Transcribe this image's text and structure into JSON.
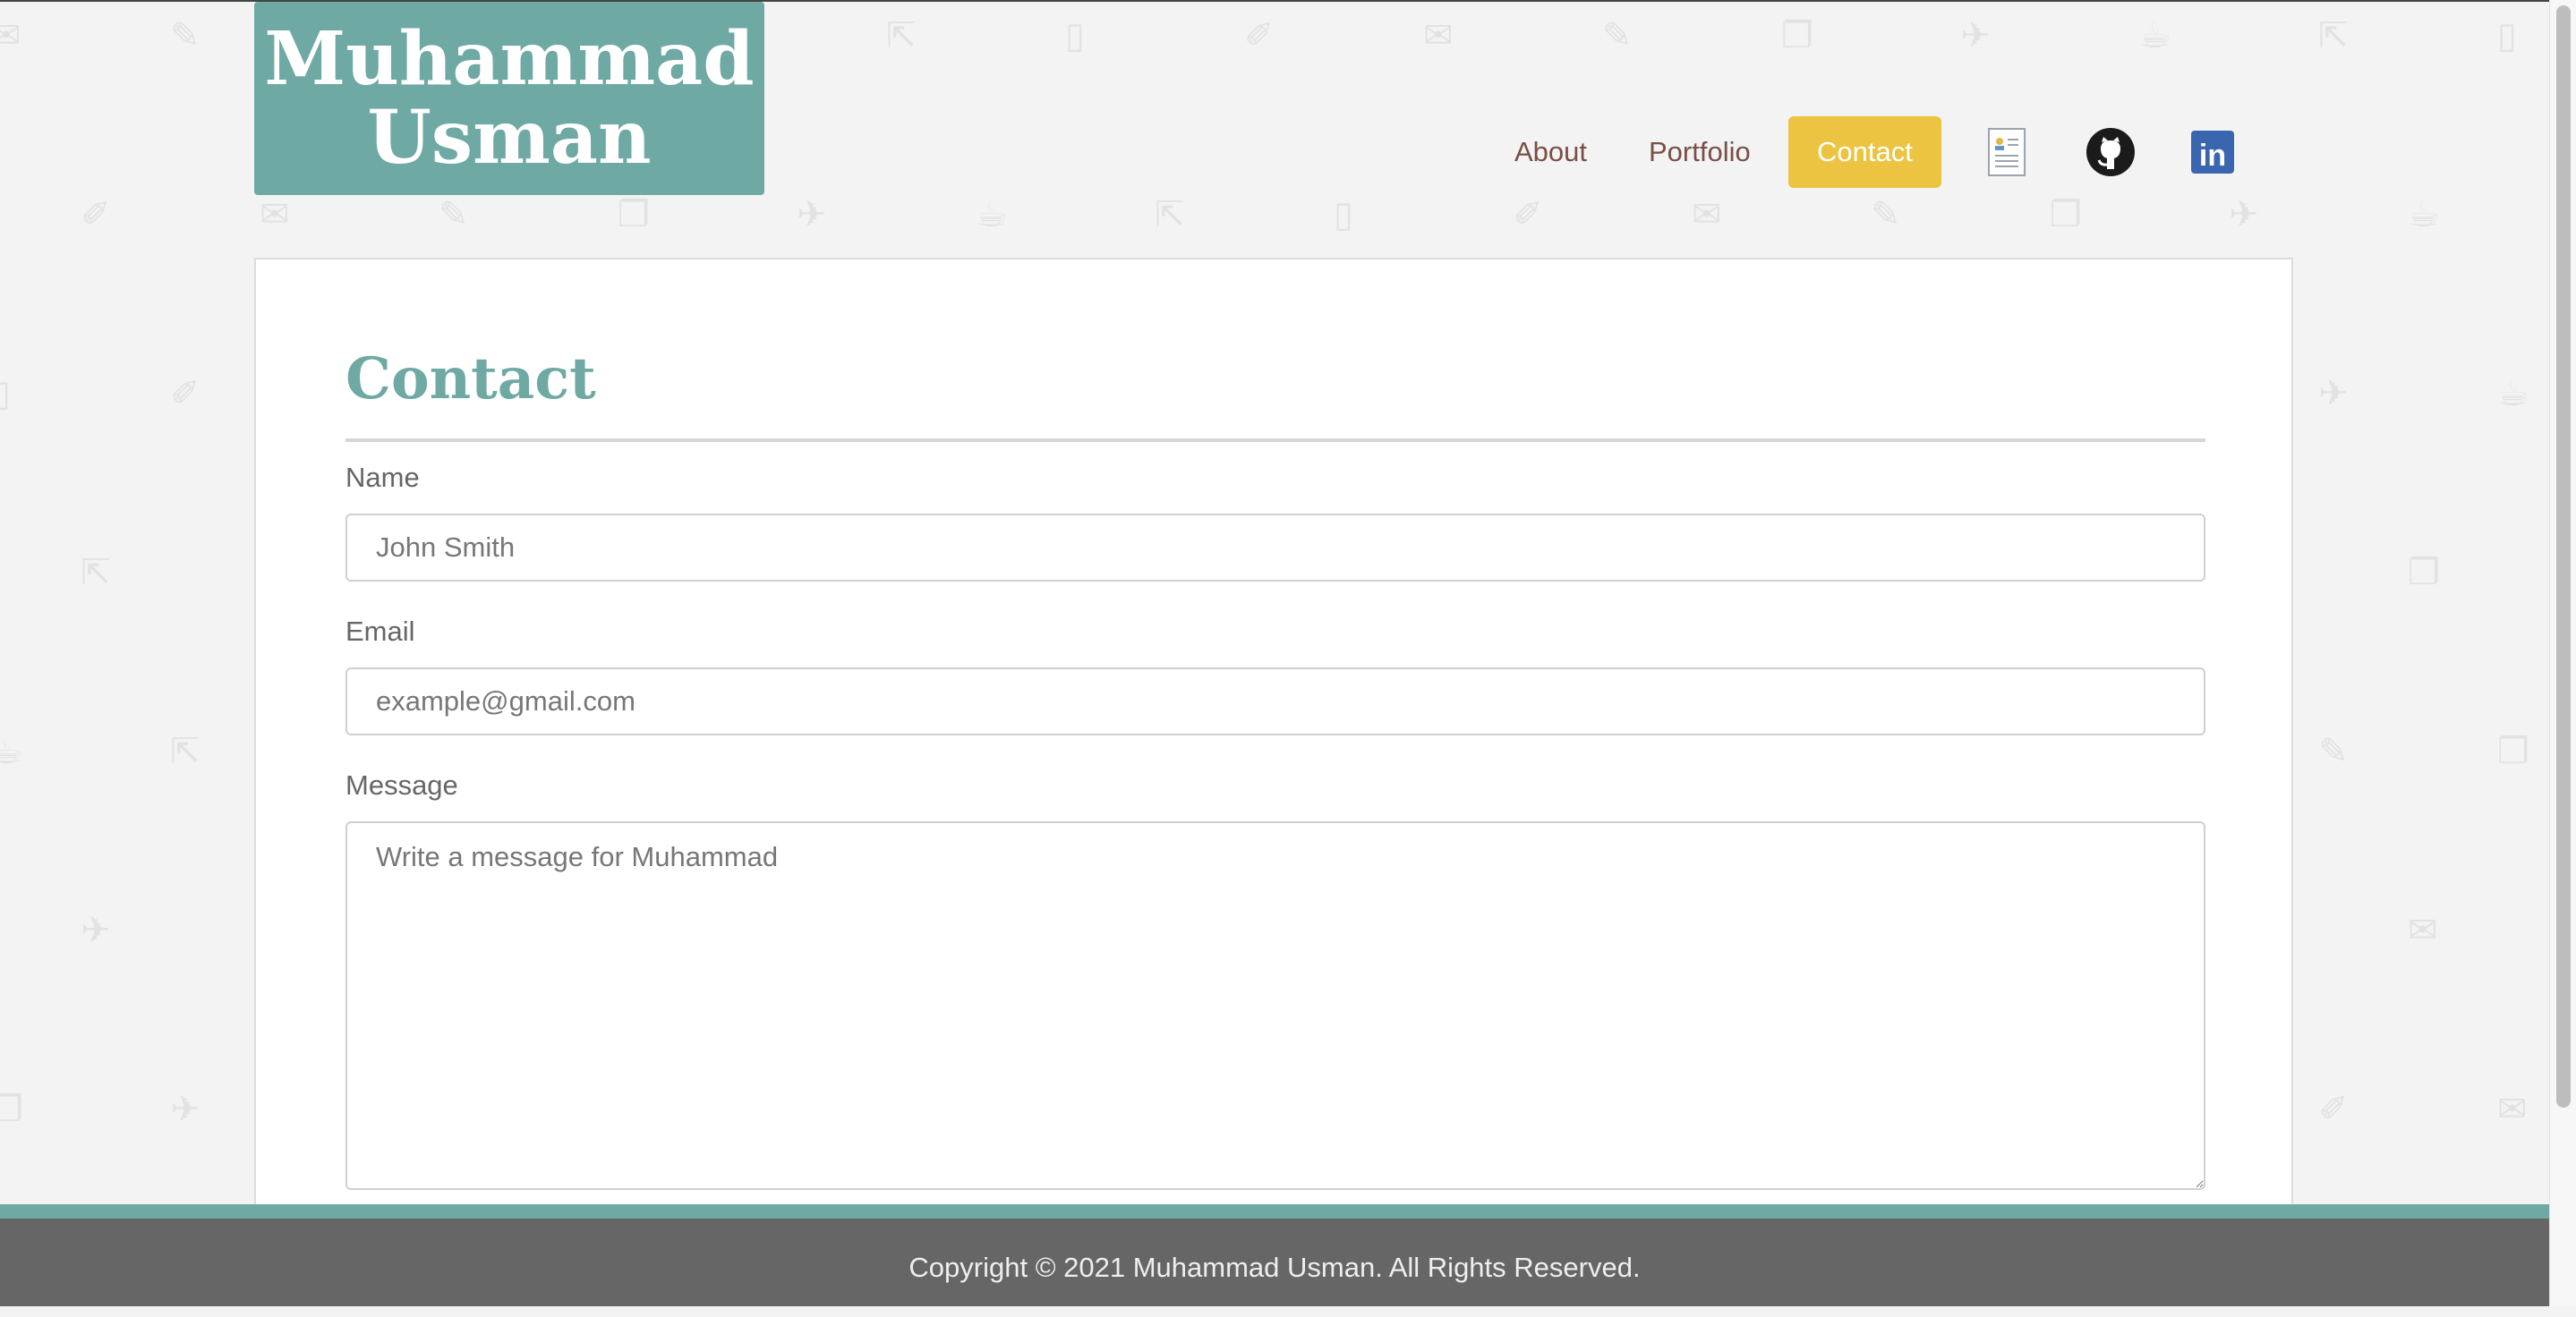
{
  "header": {
    "logo_line1": "Muhammad",
    "logo_line2": "Usman",
    "nav": [
      {
        "label": "About"
      },
      {
        "label": "Portfolio"
      },
      {
        "label": "Contact",
        "active": true
      }
    ],
    "icons": [
      "resume-icon",
      "github-icon",
      "linkedin-icon"
    ],
    "linkedin_text": "in"
  },
  "contact": {
    "title": "Contact",
    "name_label": "Name",
    "name_placeholder": "John Smith",
    "email_label": "Email",
    "email_placeholder": "example@gmail.com",
    "message_label": "Message",
    "message_placeholder": "Write a message for Muhammad"
  },
  "footer": {
    "copyright": "Copyright © 2021 Muhammad Usman. All Rights Reserved."
  },
  "colors": {
    "accent_teal": "#6fa9a3",
    "active_nav_yellow": "#ecc442",
    "nav_text": "#7a4f45",
    "footer_bg": "#666666",
    "page_bg": "#f3f3f3",
    "linkedin_blue": "#3a66b0"
  }
}
